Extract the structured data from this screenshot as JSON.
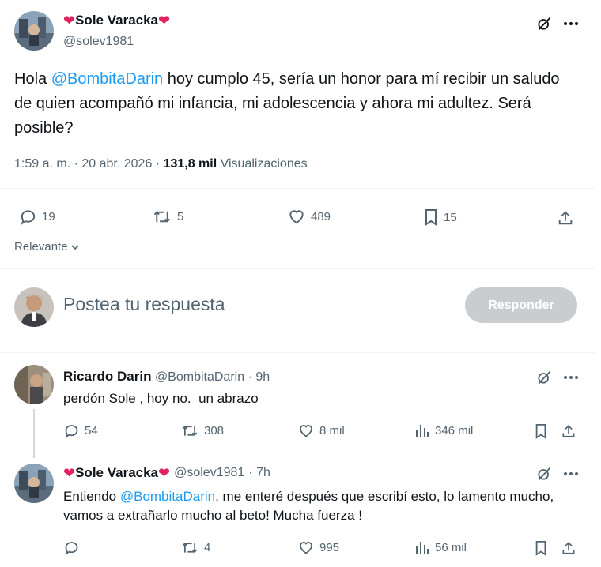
{
  "main_tweet": {
    "display_name": "Sole Varacka",
    "handle": "@solev1981",
    "text_parts": {
      "before": "Hola ",
      "mention": "@BombitaDarin",
      "after": " hoy cumplo 45, sería un honor para mí recibir un saludo de quien acompañó mi infancia, mi adolescencia y ahora mi adultez. Será posible?"
    },
    "time": "1:59 a. m. · 20 abr. 2026 · ",
    "views_count": "131,8 mil",
    "views_label": " Visualizaciones",
    "replies": "19",
    "retweets": "5",
    "likes": "489",
    "bookmarks": "15"
  },
  "sort": {
    "label": "Relevante"
  },
  "composer": {
    "placeholder": "Postea tu respuesta",
    "reply_button": "Responder"
  },
  "replies": [
    {
      "display_name": "Ricardo Darin",
      "handle": "@BombitaDarin",
      "time": "· 9h",
      "text": "perdón Sole , hoy no.  un abrazo",
      "replies": "54",
      "retweets": "308",
      "likes": "8 mil",
      "views": "346 mil"
    },
    {
      "display_name": "Sole Varacka",
      "handle": "@solev1981",
      "time": "· 7h",
      "text_before": "Entiendo ",
      "mention": "@BombitaDarin",
      "text_after": ", me enteré después que escribí esto, lo lamento mucho, vamos a extrañarlo mucho al beto! Mucha fuerza !",
      "replies": "",
      "retweets": "4",
      "likes": "995",
      "views": "56 mil"
    }
  ],
  "colors": {
    "accent": "#1d9bf0",
    "heart": "#e0245e",
    "muted": "#536471",
    "button_disabled": "#c9cdd0"
  },
  "icons": [
    "grok-icon",
    "more-icon",
    "reply-icon",
    "retweet-icon",
    "like-icon",
    "bookmark-icon",
    "share-icon",
    "views-icon",
    "chevron-down-icon"
  ]
}
